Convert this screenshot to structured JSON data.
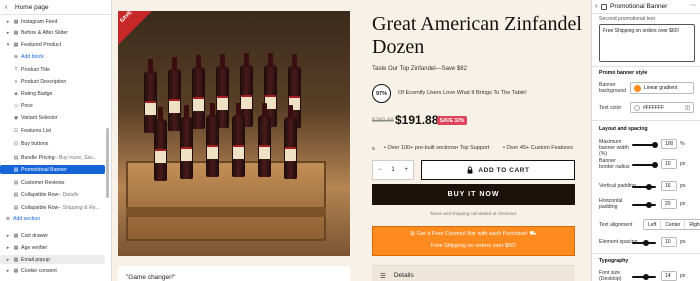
{
  "left_panel": {
    "header": "Home page",
    "items": [
      {
        "label": "Instagram Feed",
        "icon": "grid-icon"
      },
      {
        "label": "Before & After Slider",
        "icon": "grid-icon"
      },
      {
        "label": "Featured Product",
        "icon": "grid-icon"
      },
      {
        "label": "Add block",
        "icon": "plus-icon"
      },
      {
        "label": "Product Title",
        "icon": "text-icon"
      },
      {
        "label": "Product Description",
        "icon": "doc-icon"
      },
      {
        "label": "Rating Badge",
        "icon": "badge-icon"
      },
      {
        "label": "Price",
        "icon": "tag-icon"
      },
      {
        "label": "Variant Selector",
        "icon": "select-icon"
      },
      {
        "label": "Features List",
        "icon": "list-icon"
      },
      {
        "label": "Buy buttons",
        "icon": "cart-icon"
      },
      {
        "label": "Bundle Pricing",
        "sub": " – Buy more, Sav...",
        "icon": "block-icon"
      },
      {
        "label": "Promotional Banner",
        "icon": "block-icon"
      },
      {
        "label": "Customer Reviews",
        "icon": "block-icon"
      },
      {
        "label": "Collapsible Row",
        "sub": " – Details",
        "icon": "block-icon"
      },
      {
        "label": "Collapsible Row",
        "sub": " – Shipping & Re...",
        "icon": "block-icon"
      },
      {
        "label": "Add section",
        "icon": "plus-icon"
      },
      {
        "label": "Cart drawer",
        "icon": "grid-icon"
      },
      {
        "label": "Age verifier",
        "icon": "grid-icon"
      },
      {
        "label": "Email popup",
        "icon": "grid-icon"
      },
      {
        "label": "Cookie consent",
        "icon": "grid-icon"
      }
    ]
  },
  "product": {
    "sale_tag": "SAVE",
    "bottle_label": "GREAT AMERICAN ZINFANDEL",
    "title": "Great American Zinfandel Dozen",
    "tagline": "Taste Our Top Zinfandel—Save $82",
    "rating_badge": "97%",
    "rating_text": "Of Ecomify Users Love What It Brings To The Table!",
    "old_price": "$283.88",
    "price": "$191.88",
    "save_badge": "SAVE 32%",
    "feature_prefix": "s",
    "feature_1": "• Over 100+ pre-built sections• Top Support",
    "feature_2": "• Over 45+ Custom Features",
    "qty_minus": "−",
    "qty_value": "1",
    "qty_plus": "+",
    "add_to_cart": "ADD TO CART",
    "buy_now": "BUY IT NOW",
    "shipping_note": "Taxes and shipping calculated at checkout.",
    "promo_line1": "Get a Free Coconut Bar with each Purchase!",
    "promo_line2": "Free Shipping on orders over $60!",
    "details": "Details",
    "review_quote": "\"Game changer!\""
  },
  "right_panel": {
    "header": "Promotional Banner",
    "second_text_label": "Second promotional text",
    "second_text_value": "Free Shipping on orders over $60!",
    "style_heading": "Promo banner style",
    "bg_label": "Banner background",
    "bg_value": "Linear gradient",
    "text_color_label": "Text color",
    "text_color_value": "#FFFFFF",
    "layout_heading": "Layout and spacing",
    "max_width_label": "Maximum banner width (%)",
    "max_width_value": "100",
    "max_width_unit": "%",
    "radius_label": "Banner border radius",
    "radius_value": "10",
    "vpad_label": "Vertical padding",
    "vpad_value": "16",
    "hpad_label": "Horizontal padding",
    "hpad_value": "20",
    "align_label": "Text alignment",
    "align_options": [
      "Left",
      "Center",
      "Right"
    ],
    "spacing_label": "Element spacing",
    "spacing_value": "10",
    "typo_heading": "Typography",
    "font_size_label": "Font size (Desktop)",
    "font_size_value": "14",
    "px_unit": "px",
    "colors": {
      "accent": "#1565d8",
      "banner": "#ff8a1d",
      "swatch": "#ff8a1d",
      "white": "#FFFFFF"
    }
  }
}
